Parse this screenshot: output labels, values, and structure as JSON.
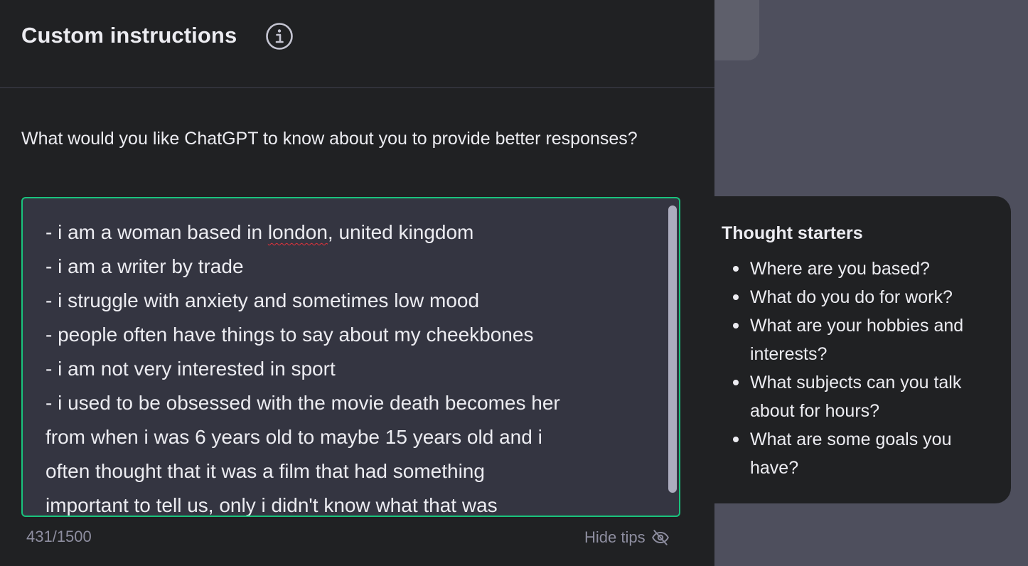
{
  "modal": {
    "title": "Custom instructions",
    "question": "What would you like ChatGPT to know about you to provide better responses?",
    "textarea": {
      "lines": [
        "- i am a woman based in london, united kingdom",
        "- i am a writer by trade",
        "- i struggle with anxiety and sometimes low mood",
        "- people often have things to say about my cheekbones",
        "- i am not very interested in sport",
        "- i used to be obsessed with the movie death becomes her",
        "from when i was 6 years old to maybe 15 years old and i",
        "often thought that it was a film that had something",
        "important to tell us, only i didn't know what that was"
      ],
      "line1_prefix": "- i am a woman based in ",
      "line1_misspelled": "london",
      "line1_suffix": ", united kingdom"
    },
    "char_count": "431/1500",
    "hide_tips_label": "Hide tips"
  },
  "tips": {
    "title": "Thought starters",
    "items": [
      "Where are you based?",
      "What do you do for work?",
      "What are your hobbies and interests?",
      "What subjects can you talk about for hours?",
      "What are some goals you have?"
    ]
  },
  "icons": {
    "info": "info-icon",
    "hide_tips": "eye-off-icon"
  },
  "colors": {
    "accent_focus_border": "#19c37d",
    "spellcheck_underline": "#e0323a"
  }
}
